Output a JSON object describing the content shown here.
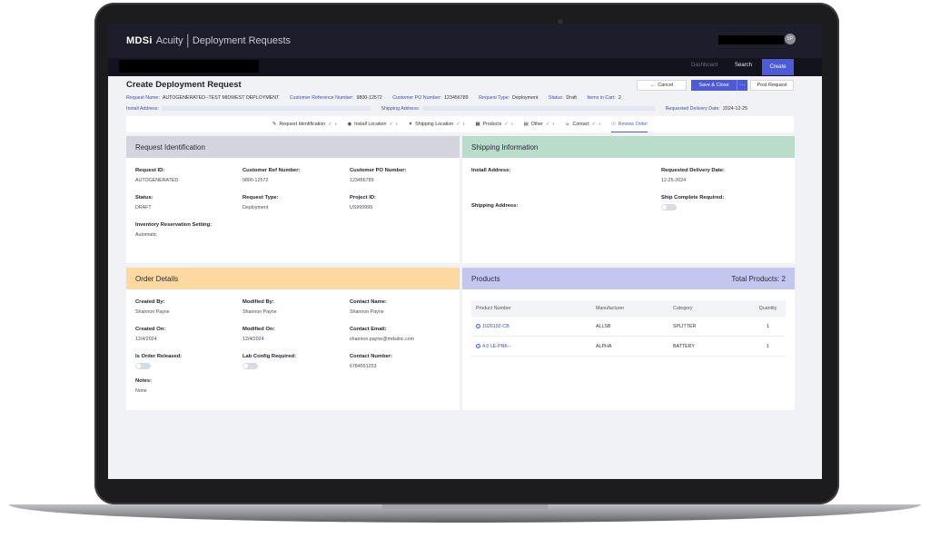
{
  "app": {
    "brand": "MDSi",
    "product": "Acuity",
    "section": "Deployment Requests",
    "user_initials": "SP"
  },
  "nav": {
    "dashboard": "Dashboard",
    "search": "Search",
    "create": "Create"
  },
  "page": {
    "title": "Create Deployment Request",
    "actions": {
      "cancel": "Cancel",
      "save_close": "Save & Close",
      "more": "···",
      "post": "Post Request"
    }
  },
  "meta": {
    "request_name_label": "Request Name:",
    "request_name": "AUTOGENERATED--TEST MIDWEST DEPLOYMENT",
    "customer_ref_label": "Customer Reference Number:",
    "customer_ref": "9800-12572",
    "customer_po_label": "Customer PO Number:",
    "customer_po": "123456789",
    "request_type_label": "Request Type:",
    "request_type": "Deployment",
    "status_label": "Status:",
    "status": "Draft",
    "items_label": "Items in Cart:",
    "items": "2",
    "install_address_label": "Install Address:",
    "shipping_address_label": "Shipping Address:",
    "delivery_date_label": "Requested Delivery Date:",
    "delivery_date": "2024-12-25"
  },
  "steps": [
    {
      "label": "Request Identification"
    },
    {
      "label": "Install Location"
    },
    {
      "label": "Shipping Location"
    },
    {
      "label": "Products"
    },
    {
      "label": "Other"
    },
    {
      "label": "Contact"
    },
    {
      "label": "Review Order"
    }
  ],
  "request_identification": {
    "title": "Request Identification",
    "request_id_label": "Request ID:",
    "request_id": "AUTOGENERATED",
    "customer_ref_label": "Customer Ref Number:",
    "customer_ref": "9800-12572",
    "customer_po_label": "Customer PO Number:",
    "customer_po": "123456789",
    "status_label": "Status:",
    "status": "DRAFT",
    "request_type_label": "Request Type:",
    "request_type": "Deployment",
    "project_id_label": "Project ID:",
    "project_id": "US999999",
    "inventory_label": "Inventory Reservation Setting:",
    "inventory": "Automatic"
  },
  "shipping_information": {
    "title": "Shipping Information",
    "install_address_label": "Install Address:",
    "delivery_date_label": "Requested Delivery Date:",
    "delivery_date": "12-25-2024",
    "ship_complete_label": "Ship Complete Required:",
    "shipping_address_label": "Shipping Address:"
  },
  "order_details": {
    "title": "Order Details",
    "created_by_label": "Created By:",
    "created_by": "Shannon Payne",
    "modified_by_label": "Modified By:",
    "modified_by": "Shannon Payne",
    "contact_name_label": "Contact Name:",
    "contact_name": "Shannon Payne",
    "created_on_label": "Created On:",
    "created_on": "12/4/2024",
    "modified_on_label": "Modified On:",
    "modified_on": "12/4/2024",
    "contact_email_label": "Contact Email:",
    "contact_email": "shannon.payne@mdsiinc.com",
    "released_label": "Is Order Released:",
    "lab_config_label": "Lab Config Required:",
    "contact_number_label": "Contact Number:",
    "contact_number": "6784551253",
    "notes_label": "Notes:",
    "notes": "None"
  },
  "products": {
    "title": "Products",
    "total": "Total Products: 2",
    "columns": [
      "Product Number",
      "Manufacturer",
      "Category",
      "Quantity"
    ],
    "rows": [
      {
        "product": "1026192-CB",
        "manufacturer": "ALLSB",
        "category": "SPLITTER",
        "quantity": "1"
      },
      {
        "product": "4.0 LE-PNK--",
        "manufacturer": "ALPHA",
        "category": "BATTERY",
        "quantity": "1"
      }
    ]
  },
  "colors": {
    "accent": "#4e5bd6",
    "request_identification_header": "#d4d5dc",
    "shipping_information_header": "#b9dccb",
    "order_details_header": "#fbd9a0",
    "products_header": "#c3c7f0"
  }
}
